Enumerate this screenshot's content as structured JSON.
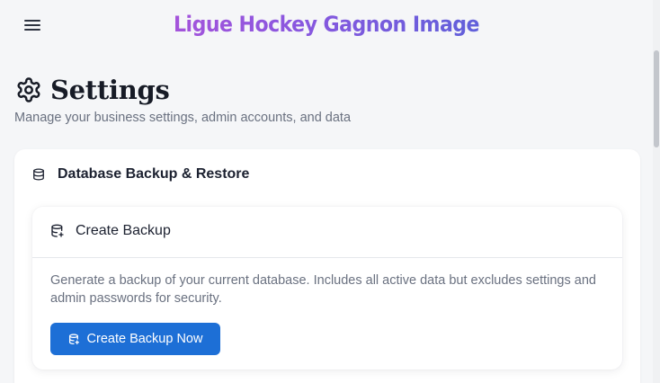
{
  "header": {
    "menu_icon": "hamburger-menu-icon",
    "brand": "Ligue Hockey Gagnon Image",
    "brand_gradient": [
      "#c44fd6",
      "#8a57df",
      "#3f67d6"
    ]
  },
  "page": {
    "icon": "gear-icon",
    "title": "Settings",
    "subtitle": "Manage your business settings, admin accounts, and data"
  },
  "backup_section": {
    "icon": "database-icon",
    "title": "Database Backup & Restore",
    "create_backup": {
      "icon": "database-plus-icon",
      "title": "Create Backup",
      "description": "Generate a backup of your current database. Includes all active data but excludes settings and admin passwords for security.",
      "button_label": "Create Backup Now",
      "button_icon": "database-plus-icon",
      "button_color": "#1d6fd6"
    }
  }
}
